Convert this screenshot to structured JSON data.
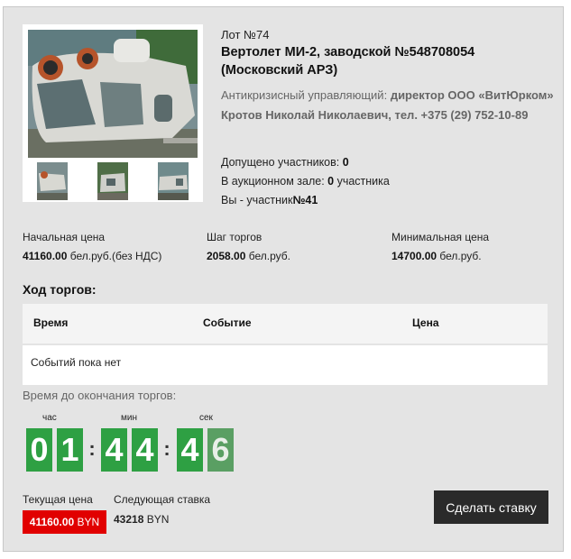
{
  "lot": {
    "number": "Лот №74",
    "title": "Вертолет МИ-2, заводской №548708054 (Московский АРЗ)",
    "manager_label": "Антикризисный управляющий:",
    "manager_company": "директор ООО «ВитЮрком»",
    "manager_name": "Кротов Николай Николаевич, тел. +375 (29) 752-10-89"
  },
  "stats": {
    "admitted_label": "Допущено участников:",
    "admitted_value": "0",
    "in_hall_label": "В аукционном зале:",
    "in_hall_value": "0",
    "in_hall_suffix": "участника",
    "you_label": "Вы - участник",
    "you_value": "№41"
  },
  "prices": {
    "start_label": "Начальная цена",
    "start_value": "41160.00",
    "start_unit": "бел.руб.(без НДС)",
    "step_label": "Шаг торгов",
    "step_value": "2058.00",
    "step_unit": "бел.руб.",
    "min_label": "Минимальная цена",
    "min_value": "14700.00",
    "min_unit": "бел.руб."
  },
  "history": {
    "title": "Ход торгов:",
    "columns": [
      "Время",
      "Событие",
      "Цена"
    ],
    "empty_text": "Событий пока нет"
  },
  "timer": {
    "label": "Время до окончания торгов:",
    "units": [
      "час",
      "мин",
      "сек"
    ],
    "digits": [
      "0",
      "1",
      "4",
      "4",
      "4",
      "6"
    ]
  },
  "current": {
    "label": "Текущая цена",
    "value": "41160.00",
    "currency": "BYN"
  },
  "next": {
    "label": "Следующая ставка",
    "value": "43218",
    "currency": "BYN"
  },
  "bid_button": "Сделать ставку",
  "colors": {
    "timer_green": "#2ea043",
    "current_price_red": "#e10000",
    "button_dark": "#2a2a2a"
  }
}
